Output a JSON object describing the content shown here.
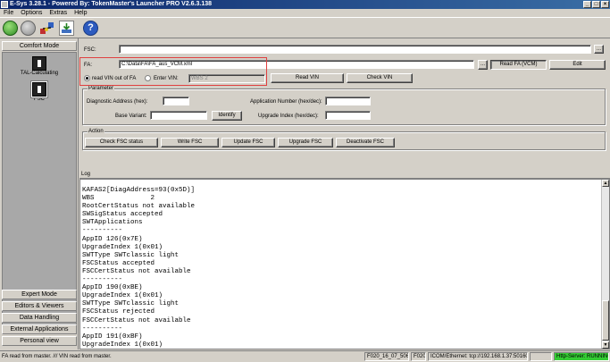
{
  "window": {
    "title": "E-Sys 3.28.1 - Powered By: TokenMaster's Launcher PRO V2.6.3.138",
    "minimize": "_",
    "maximize": "□",
    "close": "×"
  },
  "menu": [
    "File",
    "Options",
    "Extras",
    "Help"
  ],
  "toolbar": {
    "icons": [
      "connect-icon",
      "disconnect-icon",
      "network-icon",
      "download-icon",
      "help-icon"
    ],
    "help_glyph": "?"
  },
  "sidebar": {
    "comfort_mode": "Comfort Mode",
    "items": [
      {
        "label": "TAL-Calculating"
      },
      {
        "label": "FSC"
      }
    ],
    "bottom": [
      "Expert Mode",
      "Editors & Viewers",
      "Data Handling",
      "External Applications",
      "Personal view"
    ]
  },
  "fsc": {
    "label": "FSC:",
    "value": "",
    "browse": "..."
  },
  "fa": {
    "label": "FA:",
    "value": "C:\\Data\\FA\\FA_aus_VCM.xml",
    "browse": "...",
    "read_fa_button": "Read FA (VCM)",
    "edit_button": "Edit",
    "radio_read_vin": "read VIN out of FA",
    "radio_enter_vin": "Enter VIN:",
    "vin_value": "WBS                    2",
    "read_vin_button": "Read VIN",
    "check_vin_button": "Check VIN"
  },
  "parameter": {
    "title": "Parameter",
    "diag_label": "Diagnostic Address (hex):",
    "diag_value": "",
    "app_num_label": "Application Number (hex/dec):",
    "app_num_value": "",
    "base_variant_label": "Base Variant:",
    "base_variant_value": "",
    "identify_button": "Identify",
    "upgrade_index_label": "Upgrade Index (hex/dec):",
    "upgrade_index_value": ""
  },
  "action": {
    "title": "Action",
    "buttons": [
      "Check FSC status",
      "Write FSC",
      "Update FSC",
      "Upgrade FSC",
      "Deactivate FSC"
    ]
  },
  "log": {
    "title": "Log",
    "lines": [
      "KAFAS2[DiagAddress=93(0x5D)]",
      "WBS              2",
      "RootCertStatus not available",
      "SWSigStatus accepted",
      "SWTApplications",
      "----------",
      "AppID 126(0x7E)",
      "UpgradeIndex 1(0x01)",
      "SWTType SWTclassic light",
      "FSCStatus accepted",
      "FSCCertStatus not available",
      "----------",
      "AppID 190(0xBE)",
      "UpgradeIndex 1(0x01)",
      "SWTType SWTclassic light",
      "FSCStatus rejected",
      "FSCCertStatus not available",
      "----------",
      "AppID 191(0xBF)",
      "UpgradeIndex 1(0x01)"
    ]
  },
  "status": {
    "message": "FA read from master.  ///  VIN read from master.",
    "panel1": "F020_16_07_506",
    "panel2": "F020",
    "panel3": "ICOM/Ethernet: tcp://192.168.1.37:50160",
    "panel4": "",
    "http_server": "Http-Server: RUNNING",
    "http_color": "#33cc33"
  }
}
